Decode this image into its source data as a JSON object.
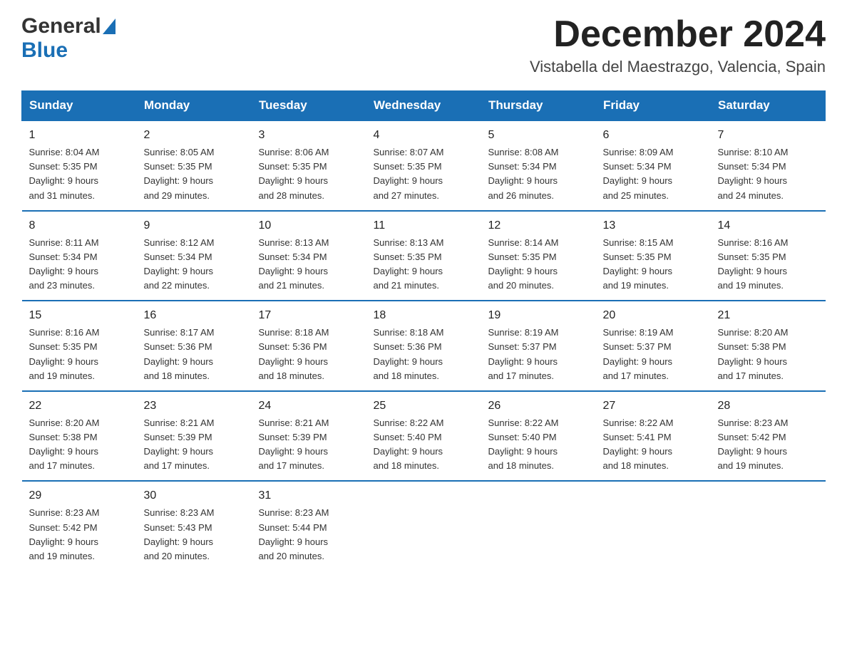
{
  "header": {
    "logo_general": "General",
    "logo_blue": "Blue",
    "month_title": "December 2024",
    "location": "Vistabella del Maestrazgo, Valencia, Spain"
  },
  "days_of_week": [
    "Sunday",
    "Monday",
    "Tuesday",
    "Wednesday",
    "Thursday",
    "Friday",
    "Saturday"
  ],
  "weeks": [
    [
      {
        "day": "1",
        "sunrise": "8:04 AM",
        "sunset": "5:35 PM",
        "daylight": "9 hours and 31 minutes."
      },
      {
        "day": "2",
        "sunrise": "8:05 AM",
        "sunset": "5:35 PM",
        "daylight": "9 hours and 29 minutes."
      },
      {
        "day": "3",
        "sunrise": "8:06 AM",
        "sunset": "5:35 PM",
        "daylight": "9 hours and 28 minutes."
      },
      {
        "day": "4",
        "sunrise": "8:07 AM",
        "sunset": "5:35 PM",
        "daylight": "9 hours and 27 minutes."
      },
      {
        "day": "5",
        "sunrise": "8:08 AM",
        "sunset": "5:34 PM",
        "daylight": "9 hours and 26 minutes."
      },
      {
        "day": "6",
        "sunrise": "8:09 AM",
        "sunset": "5:34 PM",
        "daylight": "9 hours and 25 minutes."
      },
      {
        "day": "7",
        "sunrise": "8:10 AM",
        "sunset": "5:34 PM",
        "daylight": "9 hours and 24 minutes."
      }
    ],
    [
      {
        "day": "8",
        "sunrise": "8:11 AM",
        "sunset": "5:34 PM",
        "daylight": "9 hours and 23 minutes."
      },
      {
        "day": "9",
        "sunrise": "8:12 AM",
        "sunset": "5:34 PM",
        "daylight": "9 hours and 22 minutes."
      },
      {
        "day": "10",
        "sunrise": "8:13 AM",
        "sunset": "5:34 PM",
        "daylight": "9 hours and 21 minutes."
      },
      {
        "day": "11",
        "sunrise": "8:13 AM",
        "sunset": "5:35 PM",
        "daylight": "9 hours and 21 minutes."
      },
      {
        "day": "12",
        "sunrise": "8:14 AM",
        "sunset": "5:35 PM",
        "daylight": "9 hours and 20 minutes."
      },
      {
        "day": "13",
        "sunrise": "8:15 AM",
        "sunset": "5:35 PM",
        "daylight": "9 hours and 19 minutes."
      },
      {
        "day": "14",
        "sunrise": "8:16 AM",
        "sunset": "5:35 PM",
        "daylight": "9 hours and 19 minutes."
      }
    ],
    [
      {
        "day": "15",
        "sunrise": "8:16 AM",
        "sunset": "5:35 PM",
        "daylight": "9 hours and 19 minutes."
      },
      {
        "day": "16",
        "sunrise": "8:17 AM",
        "sunset": "5:36 PM",
        "daylight": "9 hours and 18 minutes."
      },
      {
        "day": "17",
        "sunrise": "8:18 AM",
        "sunset": "5:36 PM",
        "daylight": "9 hours and 18 minutes."
      },
      {
        "day": "18",
        "sunrise": "8:18 AM",
        "sunset": "5:36 PM",
        "daylight": "9 hours and 18 minutes."
      },
      {
        "day": "19",
        "sunrise": "8:19 AM",
        "sunset": "5:37 PM",
        "daylight": "9 hours and 17 minutes."
      },
      {
        "day": "20",
        "sunrise": "8:19 AM",
        "sunset": "5:37 PM",
        "daylight": "9 hours and 17 minutes."
      },
      {
        "day": "21",
        "sunrise": "8:20 AM",
        "sunset": "5:38 PM",
        "daylight": "9 hours and 17 minutes."
      }
    ],
    [
      {
        "day": "22",
        "sunrise": "8:20 AM",
        "sunset": "5:38 PM",
        "daylight": "9 hours and 17 minutes."
      },
      {
        "day": "23",
        "sunrise": "8:21 AM",
        "sunset": "5:39 PM",
        "daylight": "9 hours and 17 minutes."
      },
      {
        "day": "24",
        "sunrise": "8:21 AM",
        "sunset": "5:39 PM",
        "daylight": "9 hours and 17 minutes."
      },
      {
        "day": "25",
        "sunrise": "8:22 AM",
        "sunset": "5:40 PM",
        "daylight": "9 hours and 18 minutes."
      },
      {
        "day": "26",
        "sunrise": "8:22 AM",
        "sunset": "5:40 PM",
        "daylight": "9 hours and 18 minutes."
      },
      {
        "day": "27",
        "sunrise": "8:22 AM",
        "sunset": "5:41 PM",
        "daylight": "9 hours and 18 minutes."
      },
      {
        "day": "28",
        "sunrise": "8:23 AM",
        "sunset": "5:42 PM",
        "daylight": "9 hours and 19 minutes."
      }
    ],
    [
      {
        "day": "29",
        "sunrise": "8:23 AM",
        "sunset": "5:42 PM",
        "daylight": "9 hours and 19 minutes."
      },
      {
        "day": "30",
        "sunrise": "8:23 AM",
        "sunset": "5:43 PM",
        "daylight": "9 hours and 20 minutes."
      },
      {
        "day": "31",
        "sunrise": "8:23 AM",
        "sunset": "5:44 PM",
        "daylight": "9 hours and 20 minutes."
      },
      null,
      null,
      null,
      null
    ]
  ],
  "labels": {
    "sunrise": "Sunrise:",
    "sunset": "Sunset:",
    "daylight": "Daylight:"
  }
}
